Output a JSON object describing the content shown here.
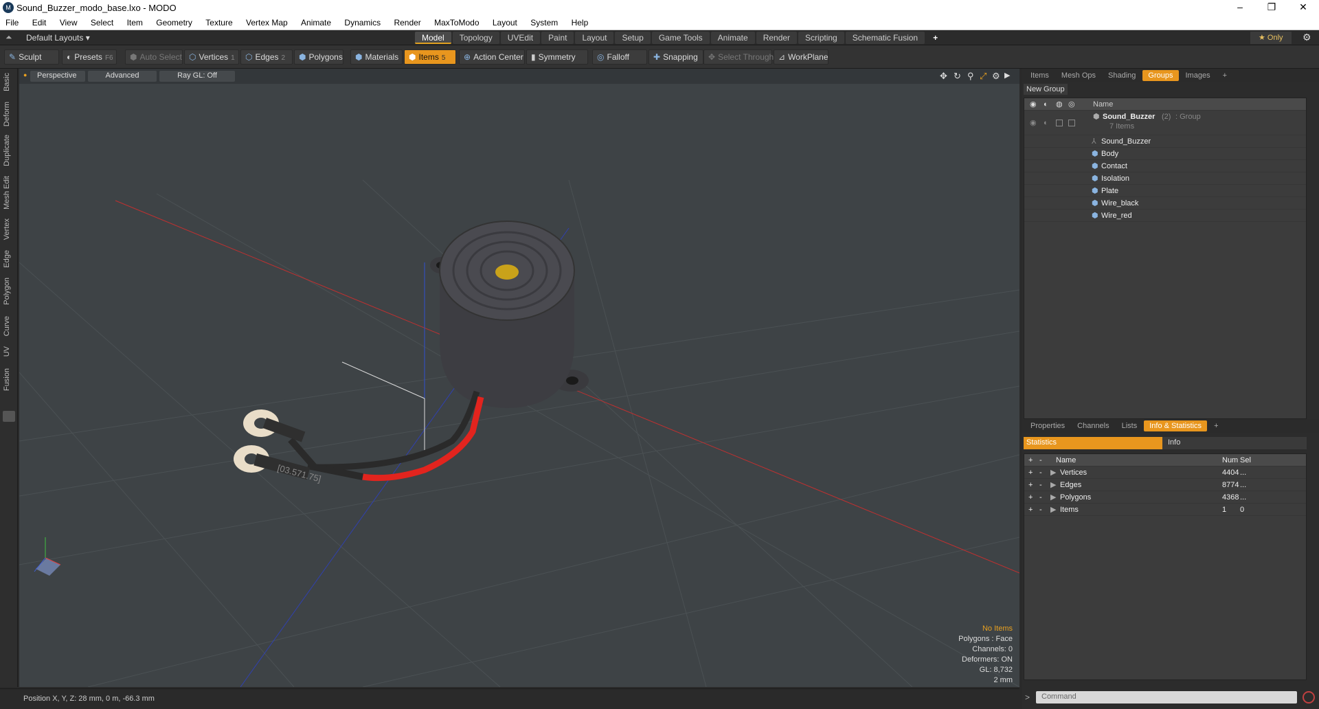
{
  "window": {
    "title": "Sound_Buzzer_modo_base.lxo - MODO",
    "min": "–",
    "max": "❐",
    "close": "✕"
  },
  "menu": [
    "File",
    "Edit",
    "View",
    "Select",
    "Item",
    "Geometry",
    "Texture",
    "Vertex Map",
    "Animate",
    "Dynamics",
    "Render",
    "MaxToModo",
    "Layout",
    "System",
    "Help"
  ],
  "layout_selector": "Default Layouts ▾",
  "layout_tabs": [
    "Model",
    "Topology",
    "UVEdit",
    "Paint",
    "Layout",
    "Setup",
    "Game Tools",
    "Animate",
    "Render",
    "Scripting",
    "Schematic Fusion"
  ],
  "only_label": "★ Only",
  "toolbar": {
    "sculpt": "Sculpt",
    "presets": "Presets",
    "presets_key": "F6",
    "auto_select": "Auto Select",
    "vertices": "Vertices",
    "vertices_key": "1",
    "edges": "Edges",
    "edges_key": "2",
    "polygons": "Polygons",
    "materials": "Materials",
    "items": "Items",
    "items_key": "5",
    "action_center": "Action Center",
    "symmetry": "Symmetry",
    "falloff": "Falloff",
    "snapping": "Snapping",
    "select_through": "Select Through",
    "workplane": "WorkPlane"
  },
  "left_tabs": [
    "Basic",
    "Deform",
    "Duplicate",
    "Mesh Edit",
    "Vertex",
    "Edge",
    "Polygon",
    "Curve",
    "UV",
    "Fusion"
  ],
  "viewport": {
    "perspective": "Perspective",
    "advanced": "Advanced",
    "raygl": "Ray GL: Off",
    "info": [
      "No Items",
      "Polygons : Face",
      "Channels: 0",
      "Deformers: ON",
      "GL: 8,732",
      "2 mm"
    ],
    "wire_text": "[03.571.75]"
  },
  "status": "Position X, Y, Z:   28 mm, 0 m, -66.3 mm",
  "right_top_tabs": [
    "Items",
    "Mesh Ops",
    "Shading",
    "Groups",
    "Images"
  ],
  "new_group": "New Group",
  "tree_header": "Name",
  "tree_group": {
    "name": "Sound_Buzzer",
    "count": "(2)",
    "type": ": Group",
    "sub": "7 Items"
  },
  "tree_items": [
    "Sound_Buzzer",
    "Body",
    "Contact",
    "Isolation",
    "Plate",
    "Wire_black",
    "Wire_red"
  ],
  "right_bottom_tabs": [
    "Properties",
    "Channels",
    "Lists",
    "Info & Statistics"
  ],
  "stats_tabs": {
    "statistics": "Statistics",
    "info": "Info"
  },
  "stats_header": {
    "name": "Name",
    "num": "Num",
    "sel": "Sel"
  },
  "stats_rows": [
    {
      "name": "Vertices",
      "num": "4404",
      "sel": "..."
    },
    {
      "name": "Edges",
      "num": "8774",
      "sel": "..."
    },
    {
      "name": "Polygons",
      "num": "4368",
      "sel": "..."
    },
    {
      "name": "Items",
      "num": "1",
      "sel": "0"
    }
  ],
  "command_placeholder": "Command"
}
